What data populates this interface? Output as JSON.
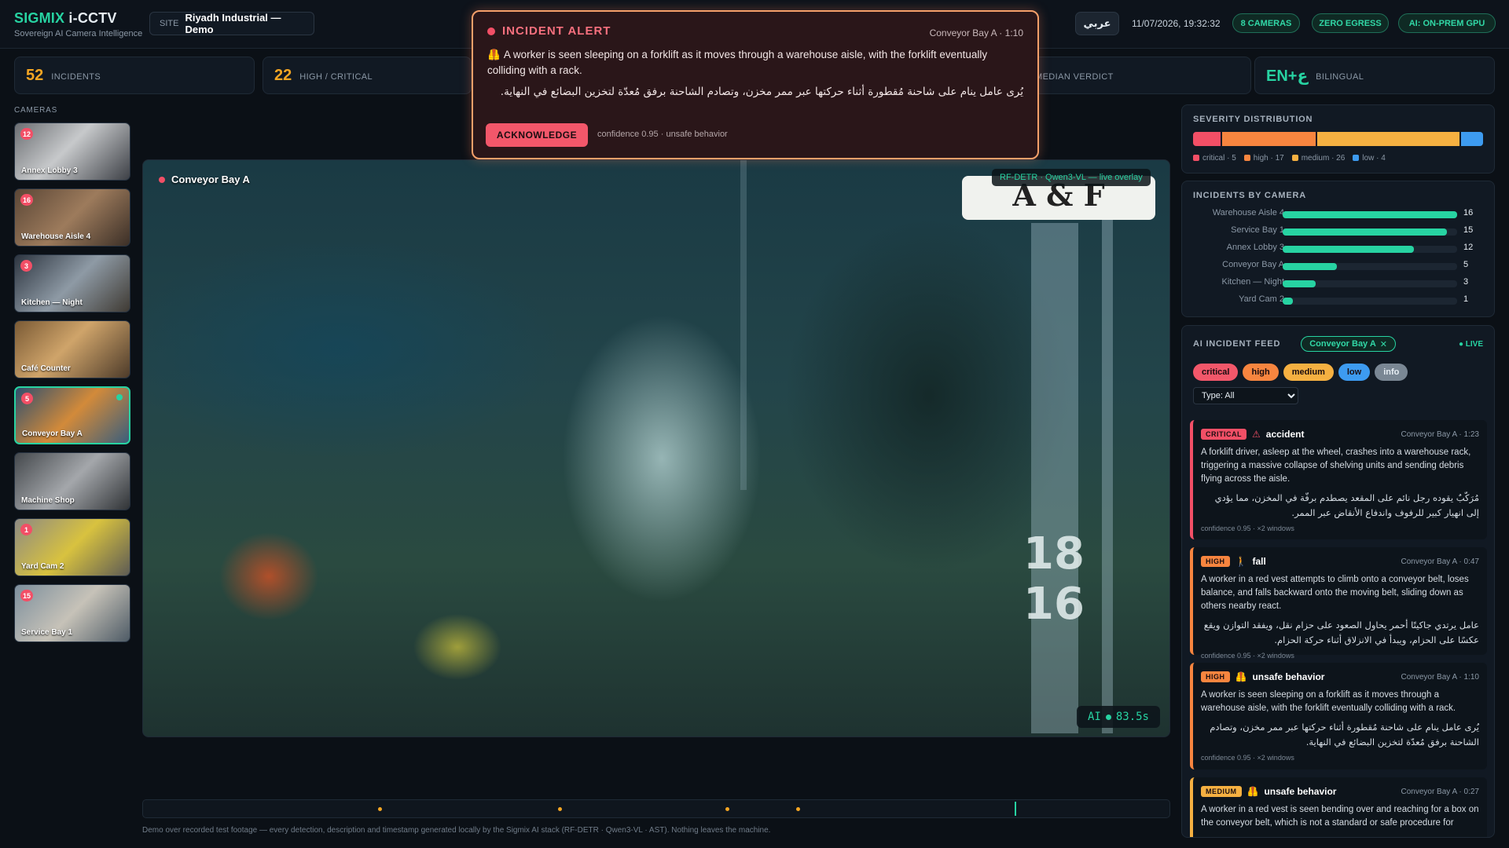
{
  "header": {
    "brand_accent": "SIGMIX",
    "brand_rest": "i-CCTV",
    "tagline": "Sovereign AI Camera Intelligence",
    "site_label": "SITE",
    "site_name": "Riyadh Industrial — Demo",
    "lang_button": "عربي",
    "datetime": "11/07/2026, 19:32:32",
    "pills": {
      "cameras": "8 CAMERAS",
      "egress": "ZERO EGRESS",
      "gpu": "AI: ON-PREM GPU"
    }
  },
  "stats": {
    "incidents": {
      "value": "52",
      "label": "INCIDENTS"
    },
    "high_critical": {
      "value": "22",
      "label": "HIGH / CRITICAL"
    },
    "median": {
      "label": "MEDIAN VERDICT"
    },
    "bilingual": {
      "value": "EN+ع",
      "label": "BILINGUAL"
    }
  },
  "cameras": {
    "title": "CAMERAS",
    "items": [
      {
        "name": "Annex Lobby 3",
        "count": "12",
        "active": false
      },
      {
        "name": "Warehouse Aisle 4",
        "count": "16",
        "active": false
      },
      {
        "name": "Kitchen — Night",
        "count": "3",
        "active": false
      },
      {
        "name": "Café Counter",
        "count": "",
        "active": false
      },
      {
        "name": "Conveyor Bay A",
        "count": "5",
        "active": true
      },
      {
        "name": "Machine Shop",
        "count": "",
        "active": false
      },
      {
        "name": "Yard Cam 2",
        "count": "1",
        "active": false
      },
      {
        "name": "Service Bay 1",
        "count": "15",
        "active": false
      }
    ]
  },
  "video": {
    "camera_name": "Conveyor Bay A",
    "overlay_tag": "RF-DETR · Qwen3-VL — live overlay",
    "scene_sign": "A & F",
    "scene_numbers": [
      "18",
      "16"
    ],
    "ai_label": "AI",
    "ai_time": "83.5s"
  },
  "timeline": {
    "markers": [
      0.23,
      0.405,
      0.568,
      0.637
    ],
    "cursor": 0.848
  },
  "footnote": "Demo over recorded test footage — every detection, description and timestamp generated locally by the Sigmix AI stack (RF-DETR · Qwen3-VL · AST). Nothing leaves the machine.",
  "alert": {
    "title": "INCIDENT ALERT",
    "camera_time": "Conveyor Bay A · 1:10",
    "text_en": "A worker is seen sleeping on a forklift as it moves through a warehouse aisle, with the forklift eventually colliding with a rack.",
    "text_ar": "يُرى عامل ينام على شاحنة مُقطورة أثناء حركتها عبر ممر مخزن، وتصادم الشاحنة برفق مُعدّة لتخزين البضائع في النهاية.",
    "button": "ACKNOWLEDGE",
    "meta": "confidence 0.95 · unsafe behavior"
  },
  "severity": {
    "title": "SEVERITY DISTRIBUTION",
    "items": [
      {
        "label": "critical",
        "count": 5,
        "color": "#f24f66"
      },
      {
        "label": "high",
        "count": 17,
        "color": "#f7853f"
      },
      {
        "label": "medium",
        "count": 26,
        "color": "#f5b041"
      },
      {
        "label": "low",
        "count": 4,
        "color": "#3d9bf0"
      }
    ],
    "legend": [
      "critical · 5",
      "high · 17",
      "medium · 26",
      "low · 4"
    ]
  },
  "by_camera": {
    "title": "INCIDENTS BY CAMERA",
    "max": 16,
    "rows": [
      {
        "name": "Warehouse Aisle 4",
        "value": 16
      },
      {
        "name": "Service Bay 1",
        "value": 15
      },
      {
        "name": "Annex Lobby 3",
        "value": 12
      },
      {
        "name": "Conveyor Bay A",
        "value": 5
      },
      {
        "name": "Kitchen — Night",
        "value": 3
      },
      {
        "name": "Yard Cam 2",
        "value": 1
      }
    ]
  },
  "feed": {
    "title": "AI INCIDENT FEED",
    "filter": "Conveyor Bay A",
    "live": "● LIVE",
    "chips": [
      {
        "label": "critical",
        "color": "#f2576a"
      },
      {
        "label": "high",
        "color": "#f7853f"
      },
      {
        "label": "medium",
        "color": "#f5b041"
      },
      {
        "label": "low",
        "color": "#3d9bf0"
      },
      {
        "label": "info",
        "color": "#7a8794"
      }
    ],
    "type_select": "Type: All",
    "cards": [
      {
        "severity": "CRITICAL",
        "color": "#f24f66",
        "icon": "⚠",
        "type": "accident",
        "when": "Conveyor Bay A · 1:23",
        "en": "A forklift driver, asleep at the wheel, crashes into a warehouse rack, triggering a massive collapse of shelving units and sending debris flying across the aisle.",
        "ar": "مُرَكّبٌ يقوده رجل نائم على المقعد يصطدم برفّة في المخزن، مما يؤدي إلى انهيار كبير للرفوف واندفاع الأنقاض عبر الممر.",
        "meta": "confidence 0.95 · ×2 windows"
      },
      {
        "severity": "HIGH",
        "color": "#f7853f",
        "icon": "🚶",
        "type": "fall",
        "when": "Conveyor Bay A · 0:47",
        "en": "A worker in a red vest attempts to climb onto a conveyor belt, loses balance, and falls backward onto the moving belt, sliding down as others nearby react.",
        "ar": "عامل يرتدي جاكيتًا أحمر يحاول الصعود على حزام نقل، ويفقد التوازن ويقع عكسًا على الحزام، ويبدأ في الانزلاق أثناء حركة الحزام.",
        "meta": "confidence 0.95 · ×2 windows"
      },
      {
        "severity": "HIGH",
        "color": "#f7853f",
        "icon": "🦺",
        "type": "unsafe behavior",
        "when": "Conveyor Bay A · 1:10",
        "en": "A worker is seen sleeping on a forklift as it moves through a warehouse aisle, with the forklift eventually colliding with a rack.",
        "ar": "يُرى عامل ينام على شاحنة مُقطورة أثناء حركتها عبر ممر مخزن، وتصادم الشاحنة برفق مُعدّة لتخزين البضائع في النهاية.",
        "meta": "confidence 0.95 · ×2 windows"
      },
      {
        "severity": "MEDIUM",
        "color": "#f5b041",
        "icon": "🦺",
        "type": "unsafe behavior",
        "when": "Conveyor Bay A · 0:27",
        "en": "A worker in a red vest is seen bending over and reaching for a box on the conveyor belt, which is not a standard or safe procedure for",
        "ar": "",
        "meta": ""
      }
    ]
  },
  "colors": {
    "accent": "#27d3a2",
    "critical": "#f24f66",
    "high": "#f7853f",
    "medium": "#f5b041",
    "low": "#3d9bf0"
  }
}
